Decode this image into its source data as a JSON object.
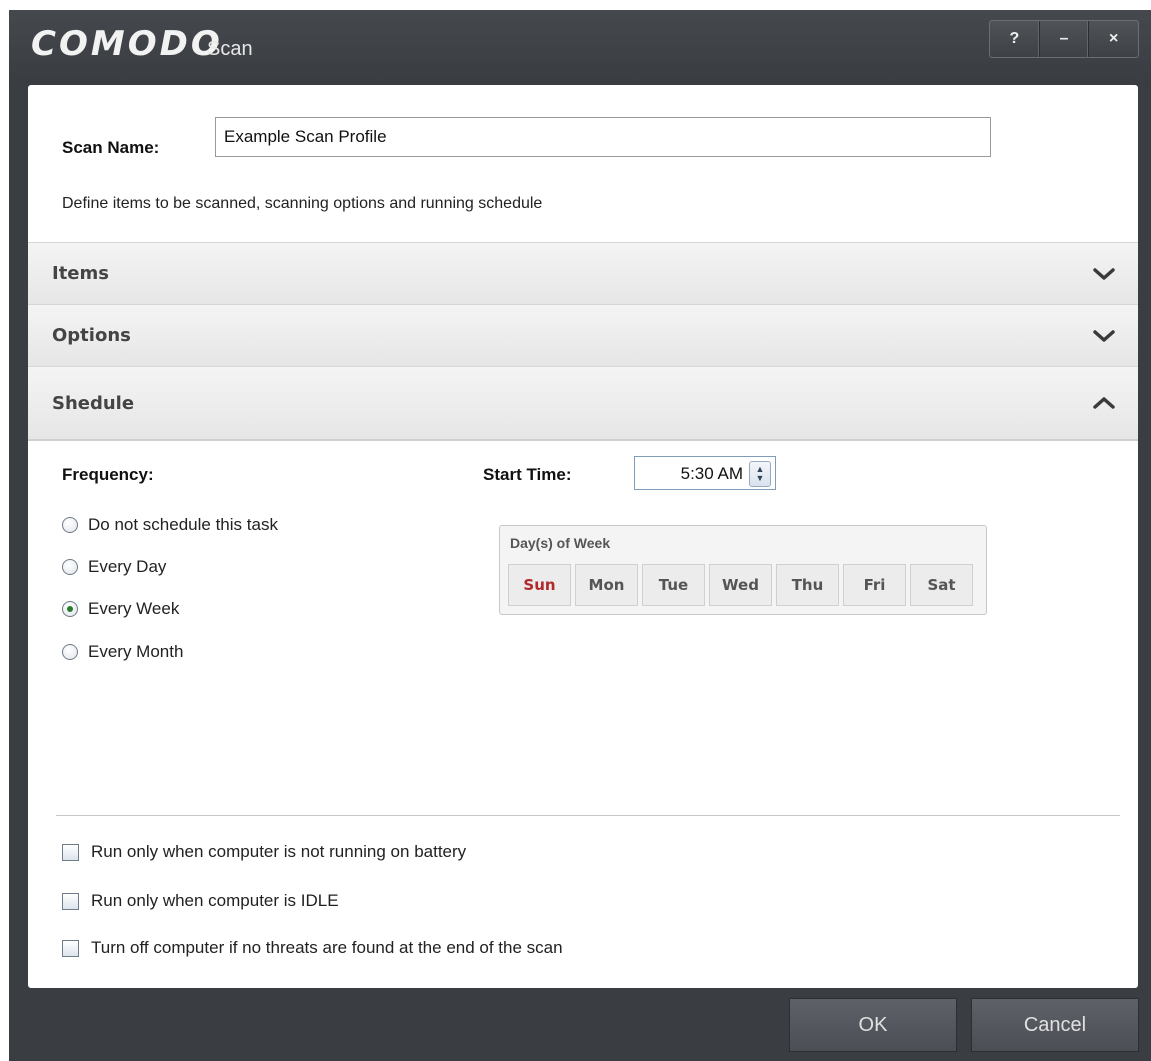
{
  "title": {
    "brand": "COMODO",
    "app": "Scan"
  },
  "window_controls": {
    "help": "?",
    "minimize": "–",
    "close": "×"
  },
  "scan_name": {
    "label": "Scan Name:",
    "value": "Example Scan Profile"
  },
  "subtitle": "Define items to be scanned, scanning options and running schedule",
  "sections": [
    {
      "title": "Items",
      "expanded": false
    },
    {
      "title": "Options",
      "expanded": false
    },
    {
      "title": "Shedule",
      "expanded": true
    }
  ],
  "schedule": {
    "frequency_label": "Frequency:",
    "frequency_options": [
      "Do not schedule this task",
      "Every Day",
      "Every Week",
      "Every Month"
    ],
    "frequency_selected": "Every Week",
    "start_time_label": "Start Time:",
    "start_time": "5:30 AM",
    "days_title": "Day(s) of Week",
    "days": [
      "Sun",
      "Mon",
      "Tue",
      "Wed",
      "Thu",
      "Fri",
      "Sat"
    ],
    "day_selected": "Sun"
  },
  "checkboxes": [
    {
      "label": "Run only when computer is not running on battery",
      "checked": false
    },
    {
      "label": "Run only when computer is IDLE",
      "checked": false
    },
    {
      "label": "Turn off computer if no threats are found at the end of the scan",
      "checked": false
    }
  ],
  "buttons": {
    "ok": "OK",
    "cancel": "Cancel"
  },
  "colors": {
    "titlebar": "#3a3d42",
    "accent_day": "#b02a2a",
    "radio_dot": "#2a7a2a"
  }
}
